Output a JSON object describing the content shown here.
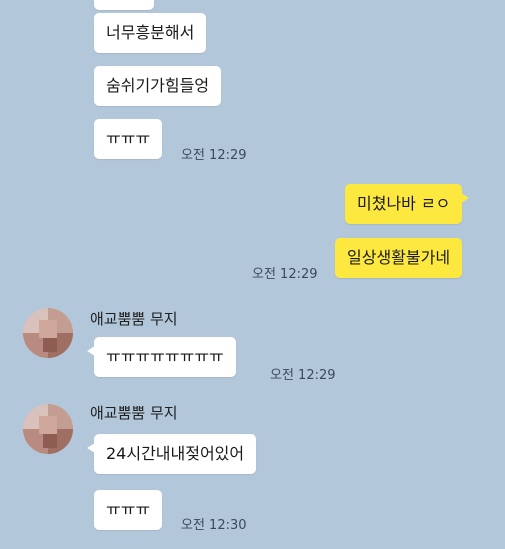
{
  "chat": {
    "messages": [
      {
        "text": "너무흥분해서"
      },
      {
        "text": "숨쉬기가힘들엉"
      },
      {
        "text": "ㅠㅠㅠ",
        "time": "오전 12:29"
      },
      {
        "text": "미쳤나바 ㄹㅇ"
      },
      {
        "text": "일상생활불가네",
        "time": "오전 12:29"
      },
      {
        "sender": "애교뿜뿜 무지",
        "text": "ㅠㅠㅠㅠㅠㅠㅠㅠ",
        "time": "오전 12:29"
      },
      {
        "sender": "애교뿜뿜 무지",
        "text": "24시간내내젖어있어"
      },
      {
        "text": "ㅠㅠㅠ",
        "time": "오전 12:30"
      }
    ]
  },
  "colors": {
    "background": "#b2c7da",
    "incoming_bubble": "#ffffff",
    "outgoing_bubble": "#fde840"
  },
  "icons": {
    "avatar": "blurred-profile-avatar"
  }
}
